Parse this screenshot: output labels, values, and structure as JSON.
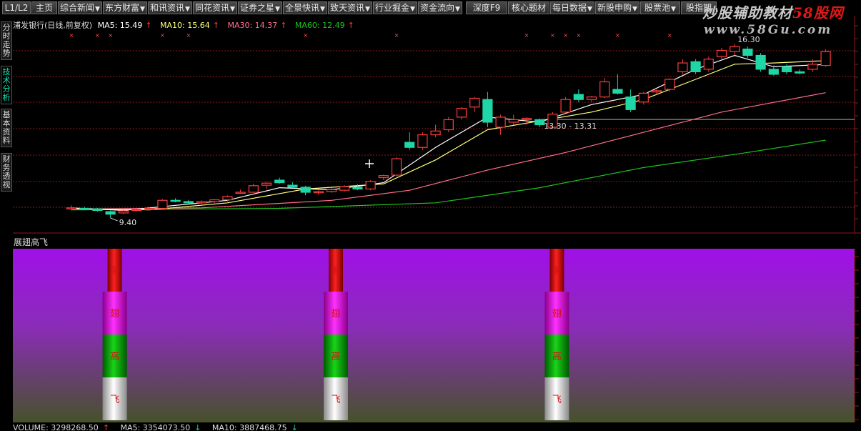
{
  "toolbar": {
    "items": [
      {
        "label": "L1/L2",
        "arrow": false
      },
      {
        "label": "主页",
        "arrow": false
      },
      {
        "label": "综合新闻",
        "arrow": true
      },
      {
        "label": "东方财富",
        "arrow": true
      },
      {
        "label": "和讯资讯",
        "arrow": true
      },
      {
        "label": "同花资讯",
        "arrow": true
      },
      {
        "label": "证券之星",
        "arrow": true
      },
      {
        "label": "全景快讯",
        "arrow": true
      },
      {
        "label": "致天资讯",
        "arrow": true
      },
      {
        "label": "行业掘金",
        "arrow": true
      },
      {
        "label": "资金流向",
        "arrow": true
      },
      {
        "label": "深度F9",
        "arrow": false
      },
      {
        "label": "核心题材",
        "arrow": false
      },
      {
        "label": "每日数据",
        "arrow": true
      },
      {
        "label": "新股申购",
        "arrow": true
      },
      {
        "label": "股票池",
        "arrow": true
      },
      {
        "label": "股指期",
        "arrow": false
      }
    ]
  },
  "brand": {
    "name_gray": "炒股辅助教材",
    "name_red": "58股网",
    "url": "www.58Gu.com"
  },
  "side_tabs": [
    {
      "label": "分时走势",
      "active": false
    },
    {
      "label": "技术分析",
      "active": true
    },
    {
      "label": "基本资料",
      "active": false
    },
    {
      "label": "财务透视",
      "active": false
    }
  ],
  "chart_header": {
    "title": "浦发银行(日线,前复权)",
    "ma5_label": "MA5: 15.49",
    "ma10_label": "MA10: 15.64",
    "ma30_label": "MA30: 14.37",
    "ma60_label": "MA60: 12.49",
    "arrow_up": "↑"
  },
  "colors": {
    "up": "#ff3b3b",
    "down": "#1fd6a6",
    "ma5": "#ffffff",
    "ma10": "#ffff7a",
    "ma30": "#ff6e8a",
    "ma60": "#1ec21e",
    "grid": "#8b1a1a",
    "marker": "#ff5050"
  },
  "chart_data": {
    "type": "candlestick",
    "price_labels": [
      "9.40",
      "13.30 - 13.31",
      "16.30"
    ],
    "price_range": [
      9.2,
      16.8
    ],
    "x_marker_indices": [
      0,
      2,
      3,
      7,
      9,
      18,
      25,
      35,
      37,
      38,
      39,
      42,
      46
    ],
    "candles": [
      {
        "o": 9.78,
        "h": 9.9,
        "l": 9.7,
        "c": 9.8
      },
      {
        "o": 9.78,
        "h": 9.85,
        "l": 9.7,
        "c": 9.76
      },
      {
        "o": 9.76,
        "h": 9.8,
        "l": 9.65,
        "c": 9.7
      },
      {
        "o": 9.65,
        "h": 9.7,
        "l": 9.4,
        "c": 9.55
      },
      {
        "o": 9.6,
        "h": 9.72,
        "l": 9.55,
        "c": 9.68
      },
      {
        "o": 9.7,
        "h": 9.8,
        "l": 9.65,
        "c": 9.74
      },
      {
        "o": 9.74,
        "h": 9.8,
        "l": 9.7,
        "c": 9.78
      },
      {
        "o": 9.78,
        "h": 10.15,
        "l": 9.76,
        "c": 10.1
      },
      {
        "o": 10.1,
        "h": 10.18,
        "l": 10.02,
        "c": 10.06
      },
      {
        "o": 10.05,
        "h": 10.12,
        "l": 9.96,
        "c": 10.0
      },
      {
        "o": 10.0,
        "h": 10.1,
        "l": 9.95,
        "c": 10.05
      },
      {
        "o": 10.05,
        "h": 10.15,
        "l": 9.98,
        "c": 10.12
      },
      {
        "o": 10.12,
        "h": 10.3,
        "l": 10.05,
        "c": 10.25
      },
      {
        "o": 10.38,
        "h": 10.52,
        "l": 10.36,
        "c": 10.42
      },
      {
        "o": 10.42,
        "h": 10.75,
        "l": 10.4,
        "c": 10.68
      },
      {
        "o": 10.7,
        "h": 10.82,
        "l": 10.55,
        "c": 10.78
      },
      {
        "o": 10.9,
        "h": 11.0,
        "l": 10.75,
        "c": 10.8
      },
      {
        "o": 10.7,
        "h": 10.82,
        "l": 10.6,
        "c": 10.62
      },
      {
        "o": 10.62,
        "h": 10.68,
        "l": 10.3,
        "c": 10.42
      },
      {
        "o": 10.4,
        "h": 10.5,
        "l": 10.32,
        "c": 10.45
      },
      {
        "o": 10.45,
        "h": 10.6,
        "l": 10.4,
        "c": 10.52
      },
      {
        "o": 10.5,
        "h": 10.7,
        "l": 10.45,
        "c": 10.65
      },
      {
        "o": 10.62,
        "h": 10.74,
        "l": 10.5,
        "c": 10.55
      },
      {
        "o": 10.55,
        "h": 10.9,
        "l": 10.5,
        "c": 10.85
      },
      {
        "o": 11.0,
        "h": 11.12,
        "l": 10.9,
        "c": 11.08
      },
      {
        "o": 11.1,
        "h": 11.8,
        "l": 11.05,
        "c": 11.75
      },
      {
        "o": 12.4,
        "h": 12.8,
        "l": 12.1,
        "c": 12.2
      },
      {
        "o": 12.2,
        "h": 12.8,
        "l": 12.1,
        "c": 12.7
      },
      {
        "o": 12.7,
        "h": 13.1,
        "l": 12.6,
        "c": 12.85
      },
      {
        "o": 12.9,
        "h": 13.4,
        "l": 12.8,
        "c": 13.3
      },
      {
        "o": 13.4,
        "h": 13.8,
        "l": 13.3,
        "c": 13.75
      },
      {
        "o": 13.8,
        "h": 14.2,
        "l": 13.6,
        "c": 14.15
      },
      {
        "o": 14.1,
        "h": 14.4,
        "l": 13.0,
        "c": 13.2
      },
      {
        "o": 13.0,
        "h": 13.5,
        "l": 12.7,
        "c": 13.4
      },
      {
        "o": 13.2,
        "h": 13.5,
        "l": 13.1,
        "c": 13.3
      },
      {
        "o": 13.3,
        "h": 13.4,
        "l": 13.1,
        "c": 13.35
      },
      {
        "o": 13.3,
        "h": 13.35,
        "l": 13.0,
        "c": 13.1
      },
      {
        "o": 13.0,
        "h": 13.6,
        "l": 12.95,
        "c": 13.52
      },
      {
        "o": 13.6,
        "h": 14.2,
        "l": 13.55,
        "c": 14.1
      },
      {
        "o": 14.3,
        "h": 14.5,
        "l": 14.0,
        "c": 14.1
      },
      {
        "o": 14.1,
        "h": 14.25,
        "l": 14.0,
        "c": 14.2
      },
      {
        "o": 14.2,
        "h": 14.95,
        "l": 14.15,
        "c": 14.8
      },
      {
        "o": 14.5,
        "h": 15.1,
        "l": 14.3,
        "c": 14.35
      },
      {
        "o": 14.2,
        "h": 14.5,
        "l": 13.6,
        "c": 13.7
      },
      {
        "o": 14.0,
        "h": 14.4,
        "l": 13.9,
        "c": 14.35
      },
      {
        "o": 14.4,
        "h": 14.5,
        "l": 14.3,
        "c": 14.45
      },
      {
        "o": 14.5,
        "h": 14.95,
        "l": 14.4,
        "c": 14.9
      },
      {
        "o": 15.2,
        "h": 15.7,
        "l": 15.1,
        "c": 15.55
      },
      {
        "o": 15.6,
        "h": 15.7,
        "l": 15.1,
        "c": 15.2
      },
      {
        "o": 15.3,
        "h": 15.8,
        "l": 15.2,
        "c": 15.7
      },
      {
        "o": 15.8,
        "h": 16.15,
        "l": 15.7,
        "c": 16.05
      },
      {
        "o": 16.0,
        "h": 16.3,
        "l": 15.85,
        "c": 16.2
      },
      {
        "o": 16.1,
        "h": 16.2,
        "l": 15.75,
        "c": 15.85
      },
      {
        "o": 15.85,
        "h": 15.95,
        "l": 15.2,
        "c": 15.3
      },
      {
        "o": 15.3,
        "h": 15.45,
        "l": 15.05,
        "c": 15.1
      },
      {
        "o": 15.4,
        "h": 15.5,
        "l": 15.1,
        "c": 15.2
      },
      {
        "o": 15.2,
        "h": 15.3,
        "l": 15.1,
        "c": 15.15
      },
      {
        "o": 15.3,
        "h": 15.7,
        "l": 15.2,
        "c": 15.5
      },
      {
        "o": 15.45,
        "h": 16.1,
        "l": 15.4,
        "c": 16.0
      }
    ],
    "ma5": [
      [
        0,
        9.8
      ],
      [
        4,
        9.7
      ],
      [
        8,
        9.9
      ],
      [
        12,
        10.1
      ],
      [
        16,
        10.6
      ],
      [
        20,
        10.52
      ],
      [
        24,
        10.8
      ],
      [
        28,
        12.2
      ],
      [
        32,
        13.4
      ],
      [
        36,
        13.2
      ],
      [
        40,
        13.9
      ],
      [
        44,
        14.3
      ],
      [
        48,
        15.3
      ],
      [
        51,
        15.85
      ],
      [
        54,
        15.4
      ],
      [
        58,
        15.49
      ]
    ],
    "ma10": [
      [
        0,
        9.78
      ],
      [
        6,
        9.72
      ],
      [
        12,
        10.0
      ],
      [
        18,
        10.55
      ],
      [
        24,
        10.75
      ],
      [
        28,
        11.7
      ],
      [
        32,
        12.9
      ],
      [
        36,
        13.25
      ],
      [
        40,
        13.6
      ],
      [
        44,
        14.1
      ],
      [
        48,
        14.9
      ],
      [
        51,
        15.5
      ],
      [
        54,
        15.55
      ],
      [
        58,
        15.64
      ]
    ],
    "ma30": [
      [
        0,
        9.75
      ],
      [
        10,
        9.8
      ],
      [
        20,
        10.1
      ],
      [
        26,
        10.5
      ],
      [
        32,
        11.3
      ],
      [
        38,
        12.0
      ],
      [
        44,
        12.8
      ],
      [
        50,
        13.6
      ],
      [
        58,
        14.37
      ]
    ],
    "ma60": [
      [
        0,
        9.72
      ],
      [
        16,
        9.78
      ],
      [
        28,
        10.0
      ],
      [
        36,
        10.6
      ],
      [
        44,
        11.4
      ],
      [
        52,
        12.0
      ],
      [
        58,
        12.49
      ]
    ]
  },
  "indicator": {
    "title": "展翅高飞",
    "segment_labels": [
      "展",
      "翅",
      "高",
      "飞"
    ],
    "signal_indices": [
      3,
      20,
      37
    ]
  },
  "volume": {
    "label": "VOLUME: 3298268.50",
    "ma5_label": "MA5: 3354073.50",
    "ma10_label": "MA10: 3887468.75",
    "arrow_up": "↑",
    "arrow_down": "↓"
  }
}
